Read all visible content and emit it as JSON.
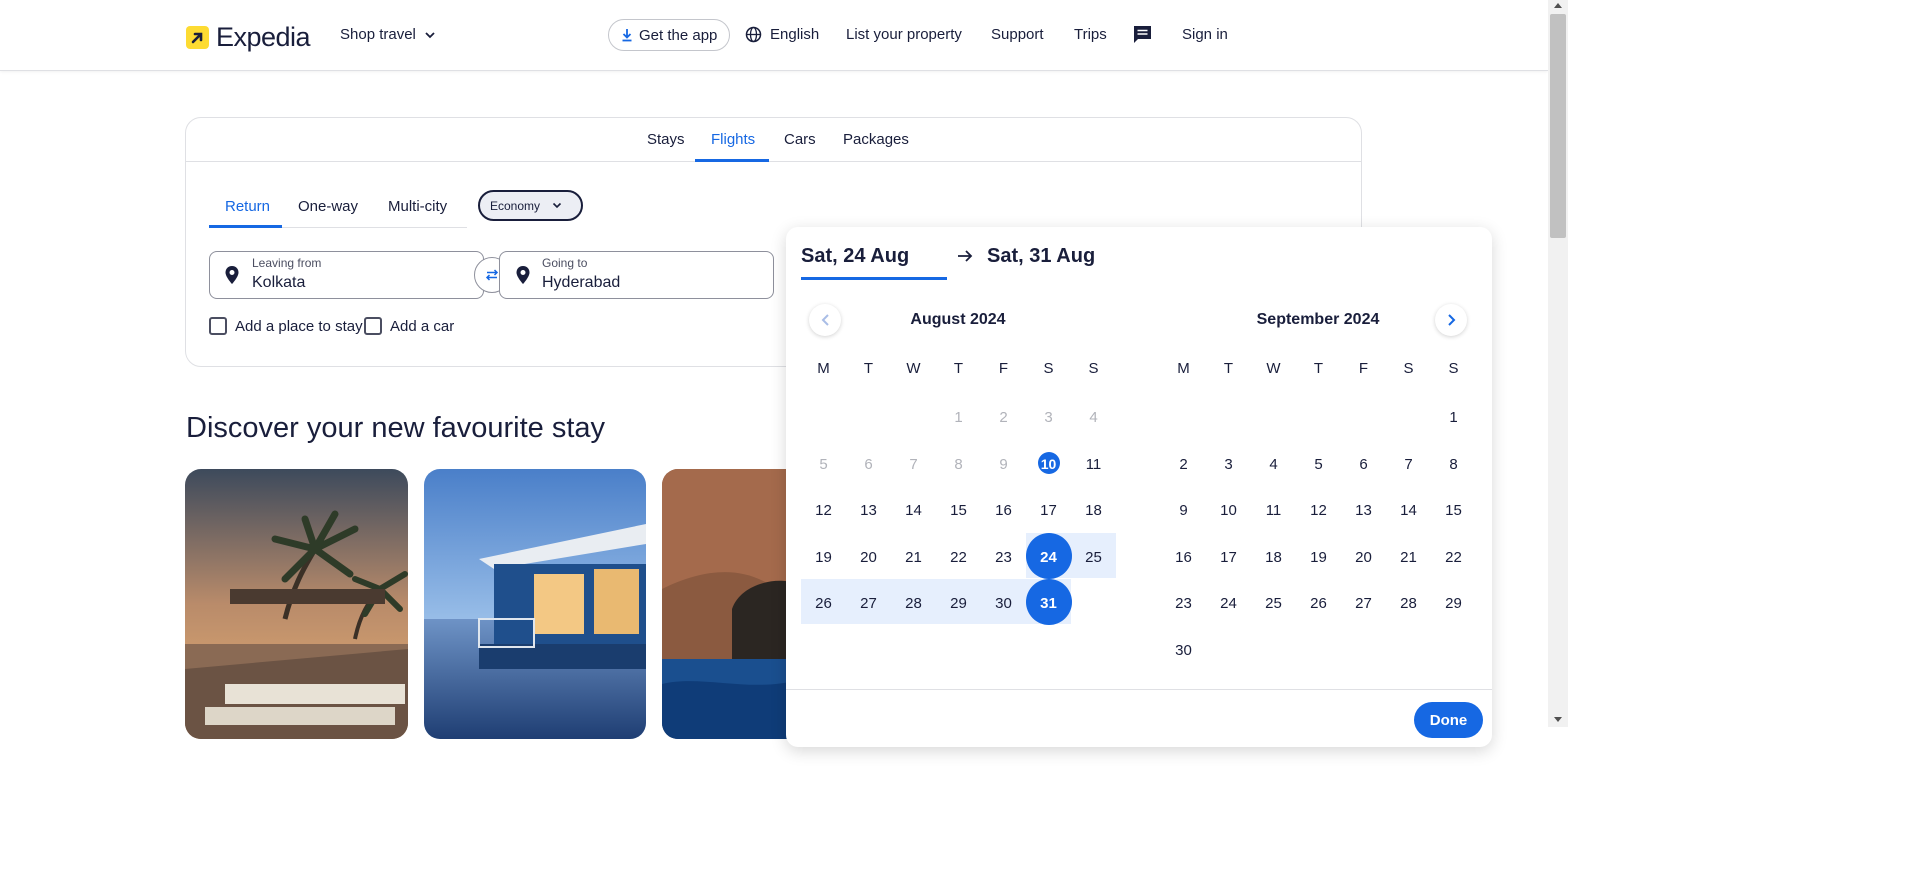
{
  "header": {
    "brand": "Expedia",
    "shop_travel": "Shop travel",
    "get_app": "Get the app",
    "language": "English",
    "list_property": "List your property",
    "support": "Support",
    "trips": "Trips",
    "sign_in": "Sign in"
  },
  "search": {
    "tabs": [
      "Stays",
      "Flights",
      "Cars",
      "Packages"
    ],
    "active_tab": "Flights",
    "trip_types": [
      "Return",
      "One-way",
      "Multi-city"
    ],
    "active_trip_type": "Return",
    "cabin_class": "Economy",
    "leaving_from": {
      "label": "Leaving from",
      "value": "Kolkata"
    },
    "going_to": {
      "label": "Going to",
      "value": "Hyderabad"
    },
    "add_stay": "Add a place to stay",
    "add_car": "Add a car"
  },
  "discover": {
    "title": "Discover your new favourite stay"
  },
  "calendar": {
    "start_date": "Sat, 24 Aug",
    "end_date": "Sat, 31 Aug",
    "weekdays": [
      "M",
      "T",
      "W",
      "T",
      "F",
      "S",
      "S"
    ],
    "months": [
      {
        "title": "August 2024",
        "first_weekday_index": 3,
        "days": 31,
        "disabled_before": 10,
        "today": 10,
        "range_start": 24,
        "range_end": 31
      },
      {
        "title": "September 2024",
        "first_weekday_index": 6,
        "days": 30
      }
    ],
    "done": "Done"
  },
  "colors": {
    "accent": "#1668e3",
    "range": "#e6effd",
    "text": "#191e3b",
    "brand_yellow": "#fddb32"
  }
}
